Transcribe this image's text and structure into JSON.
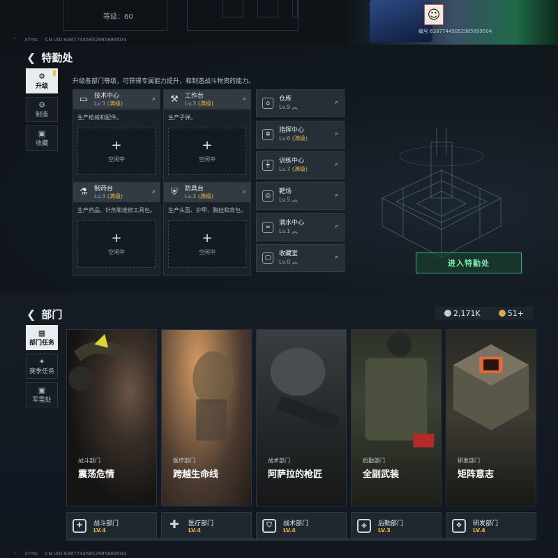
{
  "top": {
    "level_label": "等级：60",
    "uid": "编号 63877445852985899504"
  },
  "statusbar": {
    "signal": "37ms",
    "uid": "CN UID:63877445852985889504"
  },
  "special_service": {
    "title": "特勤处",
    "sidebar": [
      {
        "label": "升级",
        "icon": "upgrade-icon",
        "active": true
      },
      {
        "label": "制造",
        "icon": "craft-icon",
        "active": false
      },
      {
        "label": "收藏",
        "icon": "collection-icon",
        "active": false
      }
    ],
    "description": "升级各部门等级，可获得专属能力提升，和制造战斗物资的能力。",
    "facilities": [
      {
        "name": "技术中心",
        "level": "Lv.3",
        "max": "(满级)",
        "desc": "生产枪械和配件。",
        "slot": "空闲中",
        "icon": "monitor-icon"
      },
      {
        "name": "工作台",
        "level": "Lv.3",
        "max": "(满级)",
        "desc": "生产子弹。",
        "slot": "空闲中",
        "icon": "tools-icon"
      },
      {
        "name": "制药台",
        "level": "Lv.3",
        "max": "(满级)",
        "desc": "生产药品、针剂和维修工具包。",
        "slot": "空闲中",
        "icon": "flask-icon"
      },
      {
        "name": "防具台",
        "level": "Lv.3",
        "max": "(满级)",
        "desc": "生产头盔、护甲、胸挂和背包。",
        "slot": "空闲中",
        "icon": "armor-icon"
      }
    ],
    "rooms": [
      {
        "name": "仓库",
        "level": "Lv.9",
        "max": "",
        "icon": "vault-icon"
      },
      {
        "name": "指挥中心",
        "level": "Lv.6",
        "max": "(满级)",
        "icon": "command-icon"
      },
      {
        "name": "训练中心",
        "level": "Lv.7",
        "max": "(满级)",
        "icon": "dumbbell-icon"
      },
      {
        "name": "靶场",
        "level": "Lv.5",
        "max": "",
        "icon": "target-icon"
      },
      {
        "name": "潜水中心",
        "level": "Lv.1",
        "max": "",
        "icon": "dive-icon"
      },
      {
        "name": "收藏室",
        "level": "Lv.0",
        "max": "",
        "icon": "collection-room-icon"
      }
    ],
    "enter_button": "进入特勤处"
  },
  "departments": {
    "title": "部门",
    "currency": [
      {
        "value": "2,171K",
        "icon": "silver-coin-icon",
        "color": "#c7cbd0"
      },
      {
        "value": "51+",
        "icon": "gold-coin-icon",
        "color": "#d9a84a"
      }
    ],
    "sidebar": [
      {
        "label": "部门任务",
        "icon": "dept-task-icon",
        "active": true
      },
      {
        "label": "赛季任务",
        "icon": "season-task-icon",
        "active": false
      },
      {
        "label": "军需处",
        "icon": "quartermaster-icon",
        "active": false
      }
    ],
    "cards": [
      {
        "sub": "战斗部门",
        "title": "震荡危情",
        "dept": "战斗部门",
        "level": "LV.4",
        "icon": "combat-icon"
      },
      {
        "sub": "医疗部门",
        "title": "跨越生命线",
        "dept": "医疗部门",
        "level": "LV.4",
        "icon": "medical-icon"
      },
      {
        "sub": "战术部门",
        "title": "阿萨拉的枪匠",
        "dept": "战术部门",
        "level": "LV.4",
        "icon": "tactical-icon"
      },
      {
        "sub": "后勤部门",
        "title": "全副武装",
        "dept": "后勤部门",
        "level": "LV.3",
        "icon": "logistics-icon"
      },
      {
        "sub": "研发部门",
        "title": "矩阵意志",
        "dept": "研发部门",
        "level": "LV.4",
        "icon": "research-icon"
      }
    ]
  }
}
